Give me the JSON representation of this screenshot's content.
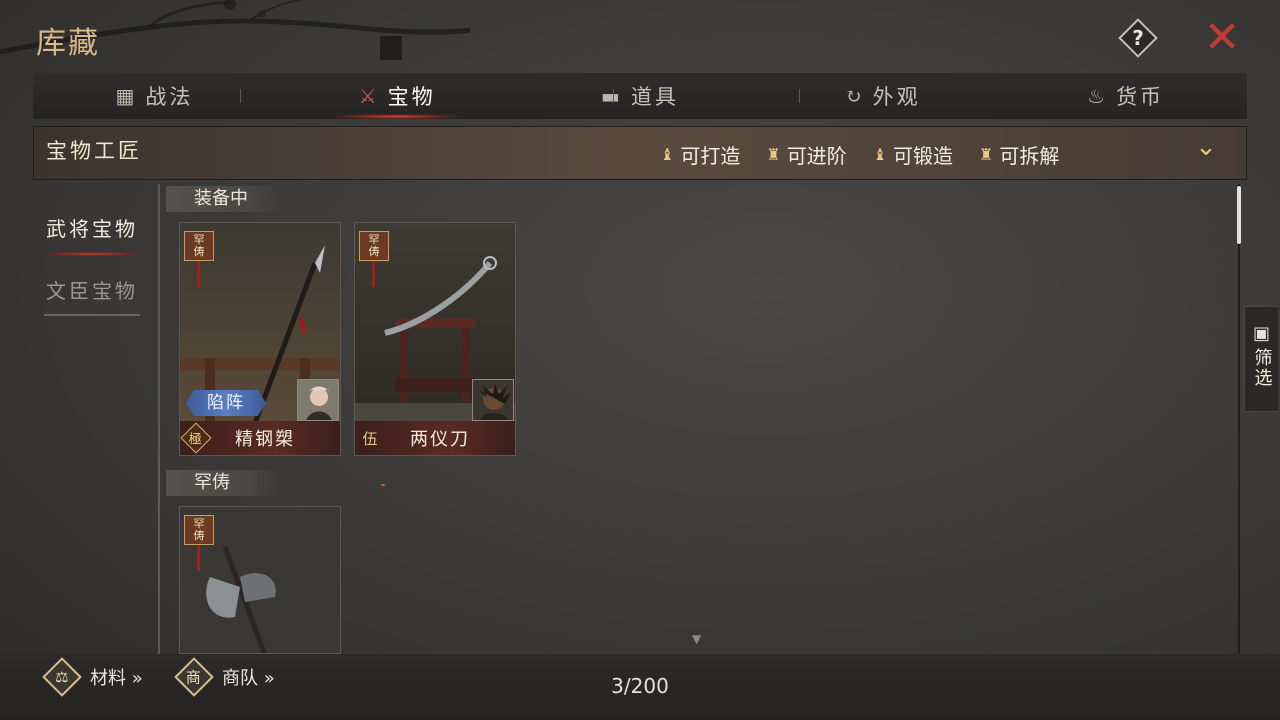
{
  "header": {
    "title": "库藏",
    "help_label": "?",
    "close_label": "✕"
  },
  "tabs": [
    {
      "label": "战法",
      "icon": "scroll-bundle-icon",
      "glyph": "▦",
      "active": false
    },
    {
      "label": "宝物",
      "icon": "treasure-rack-icon",
      "glyph": "⚔",
      "active": true
    },
    {
      "label": "道具",
      "icon": "box-icon",
      "glyph": "▬",
      "active": false
    },
    {
      "label": "外观",
      "icon": "refresh-cycle-icon",
      "glyph": "↻",
      "active": false
    },
    {
      "label": "货币",
      "icon": "money-bag-icon",
      "glyph": "♨",
      "active": false
    }
  ],
  "artisan": {
    "title": "宝物工匠",
    "actions": [
      {
        "label": "可打造",
        "icon": "anvil-figure-icon",
        "glyph": "♝"
      },
      {
        "label": "可进阶",
        "icon": "advance-figure-icon",
        "glyph": "♜"
      },
      {
        "label": "可锻造",
        "icon": "forge-figure-icon",
        "glyph": "♝"
      },
      {
        "label": "可拆解",
        "icon": "dismantle-figure-icon",
        "glyph": "♜"
      }
    ],
    "expand_icon": "chevron-down-icon",
    "expand_glyph": "⌄"
  },
  "sidenav": [
    {
      "label": "武将宝物",
      "active": true
    },
    {
      "label": "文臣宝物",
      "active": false
    }
  ],
  "sections": [
    {
      "label": "装备中"
    },
    {
      "label": "罕俦"
    }
  ],
  "cards": [
    {
      "name": "精钢槊",
      "grade": "極",
      "seal_top": "罕",
      "seal_bottom": "俦",
      "badge": "陷阵"
    },
    {
      "name": "两仪刀",
      "grade": "伍",
      "seal_top": "罕",
      "seal_bottom": "俦"
    },
    {
      "seal_top": "罕",
      "seal_bottom": "俦"
    }
  ],
  "filter": {
    "label": "筛选",
    "icon": "grid-filter-icon",
    "glyph": "▣"
  },
  "bottom": {
    "materials_label": "材料 »",
    "materials_icon_char": "⚖",
    "caravan_label": "商队 »",
    "caravan_icon_char": "商",
    "counter": "3/200"
  },
  "colors": {
    "accent_red": "#c23b33",
    "title_gold": "#d9b98a",
    "badge_blue": "#5a7fc4"
  }
}
